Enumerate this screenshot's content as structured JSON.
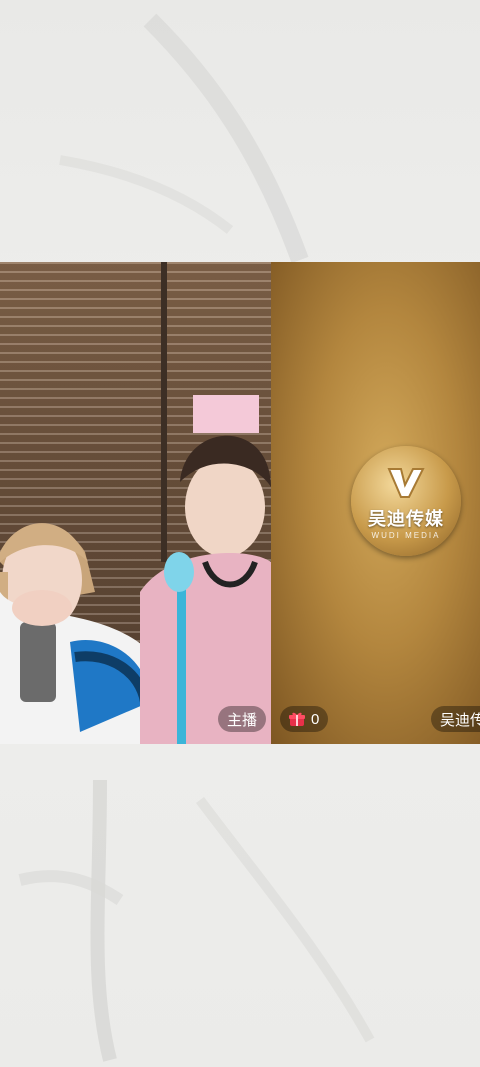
{
  "host_label": "主播",
  "gift_count": "0",
  "opponent_name": "吴迪传",
  "logo": {
    "name": "吴迪传媒",
    "subtitle": "WUDI MEDIA"
  },
  "colors": {
    "gold": "#b3863e",
    "pill_bg": "rgba(0,0,0,0.35)",
    "gift": "#e8304a"
  }
}
